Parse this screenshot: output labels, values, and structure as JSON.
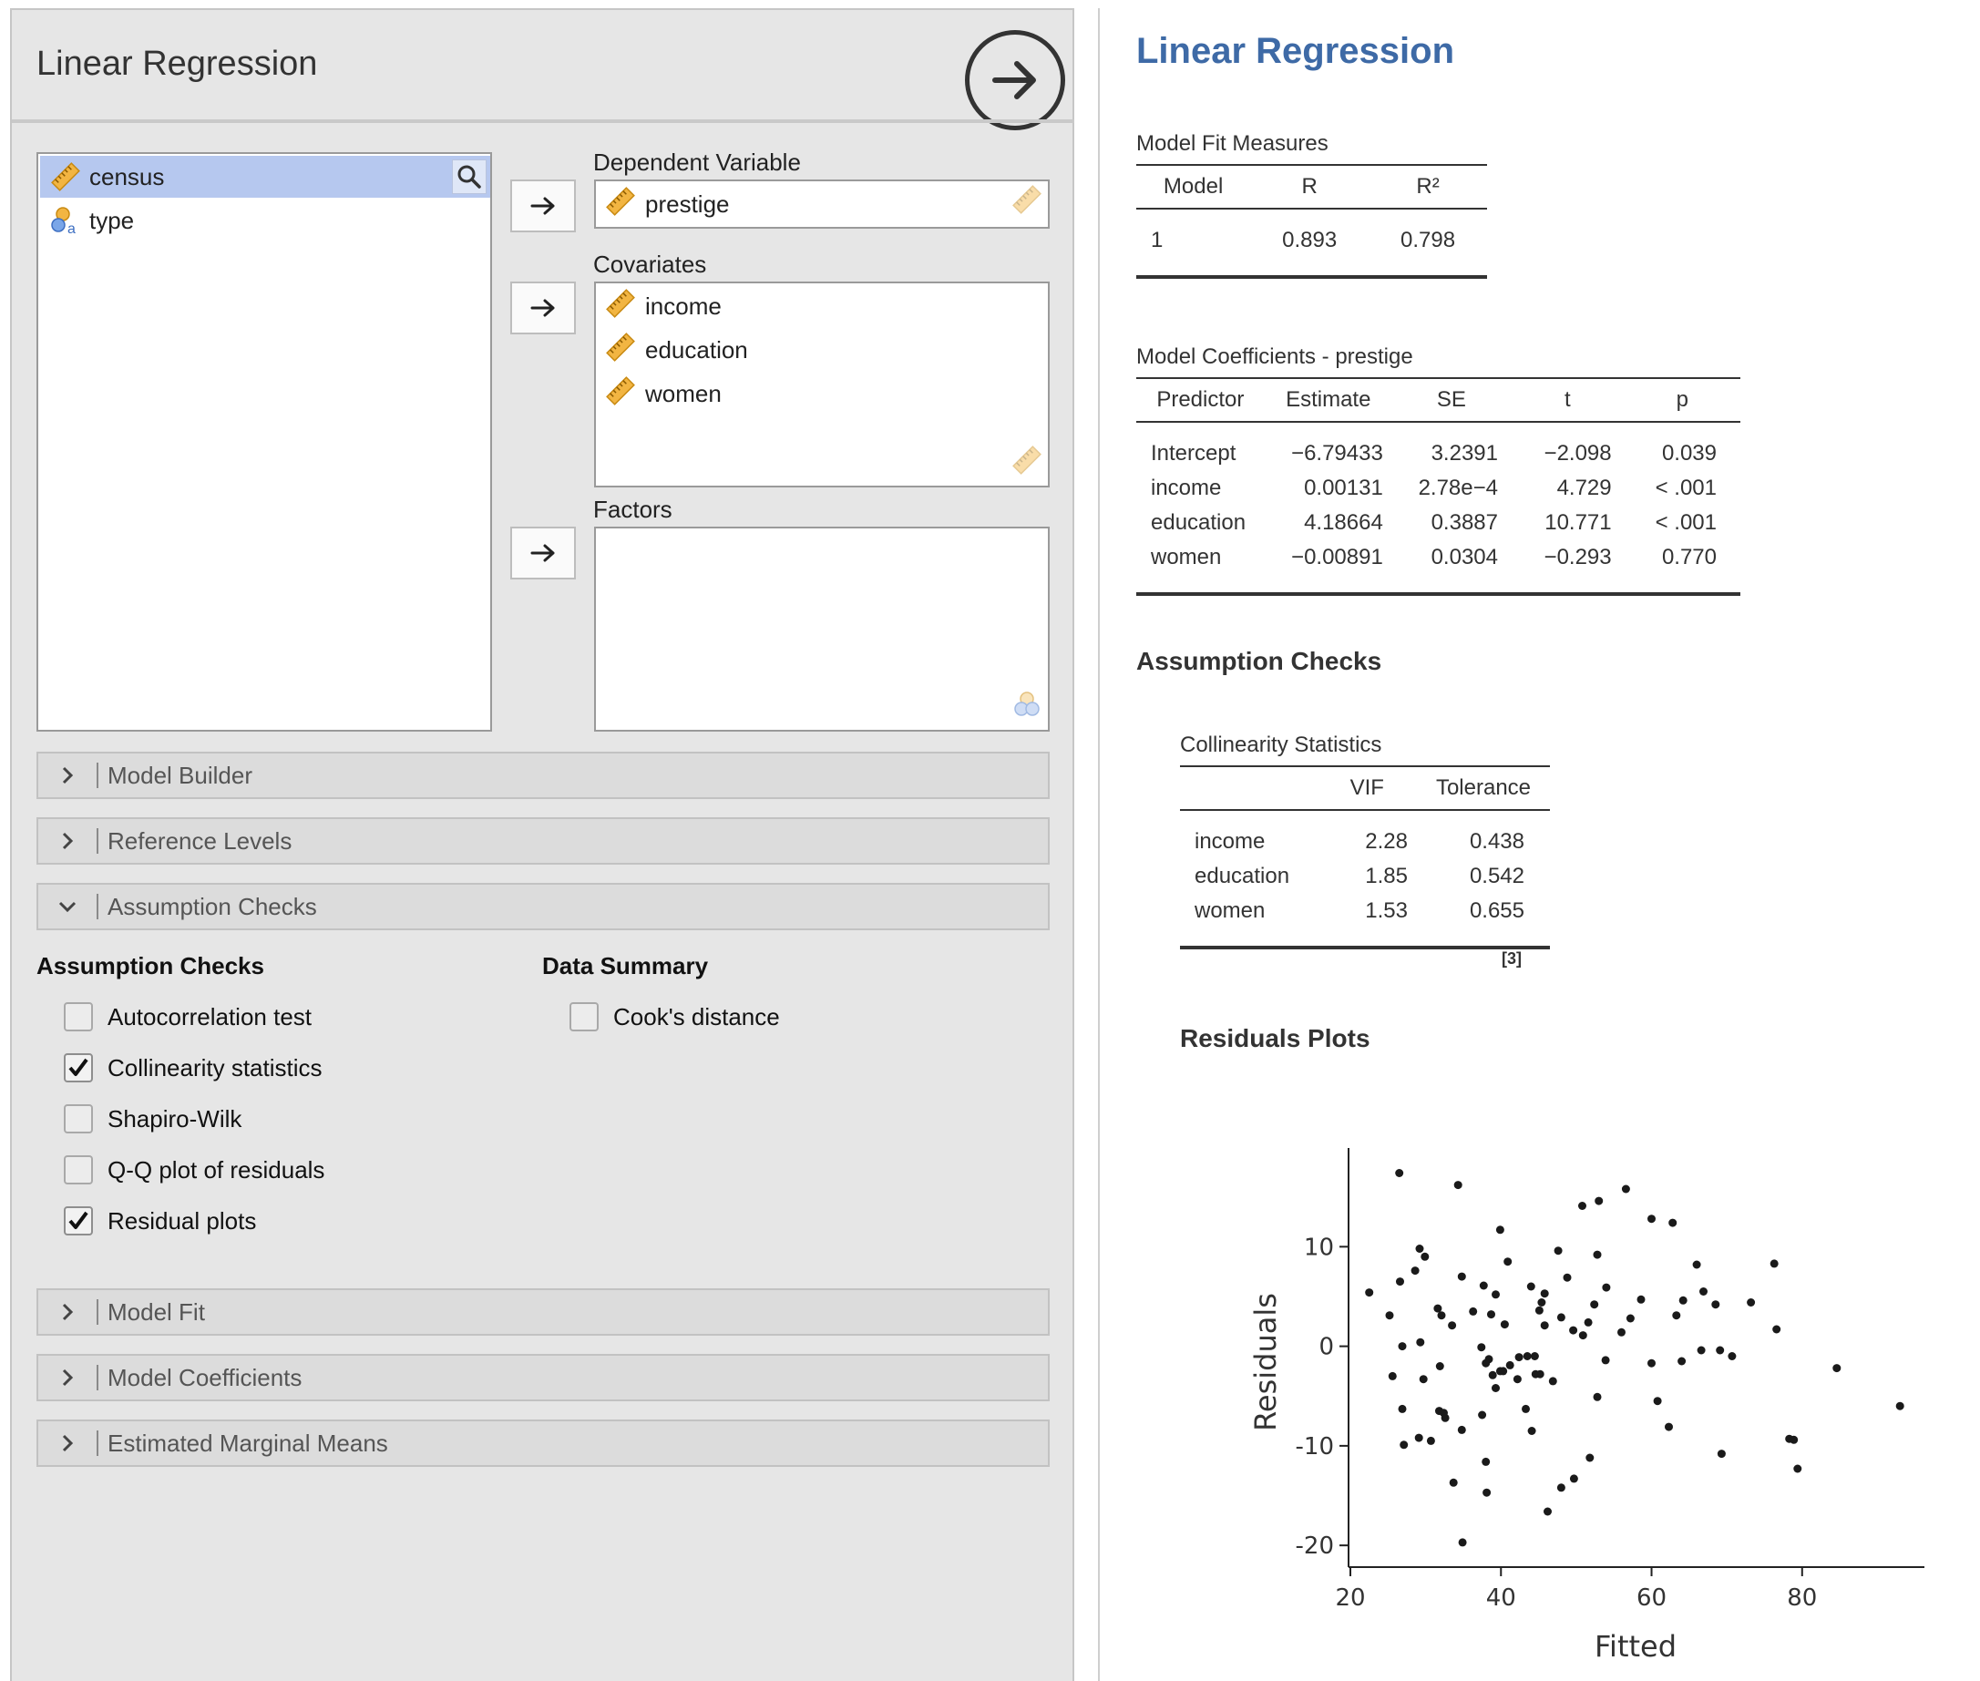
{
  "options": {
    "title": "Linear Regression",
    "variables": [
      {
        "name": "census",
        "icon": "scale-icon",
        "selected": true
      },
      {
        "name": "type",
        "icon": "nominal-icon",
        "selected": false
      }
    ],
    "dependent": {
      "label": "Dependent Variable",
      "items": [
        "prestige"
      ]
    },
    "covariates": {
      "label": "Covariates",
      "items": [
        "income",
        "education",
        "women"
      ]
    },
    "factors": {
      "label": "Factors",
      "items": []
    },
    "sections": {
      "model_builder": "Model Builder",
      "reference_levels": "Reference Levels",
      "assumption_checks": "Assumption Checks",
      "model_fit": "Model Fit",
      "model_coefficients": "Model Coefficients",
      "estimated_marginal_means": "Estimated Marginal Means"
    },
    "assumption_group": {
      "title": "Assumption Checks",
      "items": [
        {
          "label": "Autocorrelation test",
          "checked": false
        },
        {
          "label": "Collinearity statistics",
          "checked": true
        },
        {
          "label": "Shapiro-Wilk",
          "checked": false
        },
        {
          "label": "Q-Q plot of residuals",
          "checked": false
        },
        {
          "label": "Residual plots",
          "checked": true
        }
      ]
    },
    "data_summary_group": {
      "title": "Data Summary",
      "items": [
        {
          "label": "Cook's distance",
          "checked": false
        }
      ]
    }
  },
  "results": {
    "title": "Linear Regression",
    "model_fit": {
      "title": "Model Fit Measures",
      "headers": [
        "Model",
        "R",
        "R²"
      ],
      "rows": [
        [
          "1",
          "0.893",
          "0.798"
        ]
      ]
    },
    "coefficients": {
      "title": "Model Coefficients - prestige",
      "headers": [
        "Predictor",
        "Estimate",
        "SE",
        "t",
        "p"
      ],
      "rows": [
        [
          "Intercept",
          "−6.79433",
          "3.2391",
          "−2.098",
          "0.039"
        ],
        [
          "income",
          "0.00131",
          "2.78e−4",
          "4.729",
          "< .001"
        ],
        [
          "education",
          "4.18664",
          "0.3887",
          "10.771",
          "< .001"
        ],
        [
          "women",
          "−0.00891",
          "0.0304",
          "−0.293",
          "0.770"
        ]
      ]
    },
    "assumption_checks_title": "Assumption Checks",
    "collinearity": {
      "title": "Collinearity Statistics",
      "headers": [
        "",
        "VIF",
        "Tolerance"
      ],
      "rows": [
        [
          "income",
          "2.28",
          "0.438"
        ],
        [
          "education",
          "1.85",
          "0.542"
        ],
        [
          "women",
          "1.53",
          "0.655"
        ]
      ],
      "note": "[3]"
    },
    "residuals_title": "Residuals Plots"
  },
  "chart_data": {
    "type": "scatter",
    "xlabel": "Fitted",
    "ylabel": "Residuals",
    "xticks": [
      20,
      40,
      60,
      80
    ],
    "yticks": [
      -20,
      -10,
      0,
      10
    ],
    "xlim": [
      20,
      96
    ],
    "ylim": [
      -22,
      19
    ],
    "grid": false,
    "points": [
      [
        26.5,
        17.4
      ],
      [
        34.3,
        16.2
      ],
      [
        56.6,
        15.8
      ],
      [
        53.0,
        14.6
      ],
      [
        50.8,
        14.1
      ],
      [
        60.0,
        12.8
      ],
      [
        62.8,
        12.4
      ],
      [
        39.9,
        11.7
      ],
      [
        29.2,
        9.8
      ],
      [
        29.9,
        9.0
      ],
      [
        47.6,
        9.6
      ],
      [
        52.8,
        9.2
      ],
      [
        40.9,
        8.5
      ],
      [
        66.0,
        8.2
      ],
      [
        76.3,
        8.3
      ],
      [
        28.6,
        7.6
      ],
      [
        34.8,
        7.0
      ],
      [
        48.8,
        6.9
      ],
      [
        26.6,
        6.5
      ],
      [
        37.7,
        6.1
      ],
      [
        44.0,
        6.0
      ],
      [
        54.0,
        5.9
      ],
      [
        22.5,
        5.4
      ],
      [
        39.3,
        5.2
      ],
      [
        45.8,
        5.3
      ],
      [
        66.9,
        5.5
      ],
      [
        58.6,
        4.7
      ],
      [
        64.2,
        4.6
      ],
      [
        45.4,
        4.4
      ],
      [
        52.4,
        4.2
      ],
      [
        68.5,
        4.2
      ],
      [
        73.2,
        4.4
      ],
      [
        31.6,
        3.8
      ],
      [
        36.3,
        3.5
      ],
      [
        45.1,
        3.6
      ],
      [
        25.2,
        3.1
      ],
      [
        32.1,
        3.1
      ],
      [
        38.7,
        3.2
      ],
      [
        48.0,
        2.9
      ],
      [
        51.6,
        2.4
      ],
      [
        57.2,
        2.8
      ],
      [
        63.3,
        3.1
      ],
      [
        33.5,
        2.1
      ],
      [
        40.5,
        2.2
      ],
      [
        45.8,
        2.1
      ],
      [
        49.6,
        1.6
      ],
      [
        56.0,
        1.4
      ],
      [
        76.6,
        1.7
      ],
      [
        50.9,
        1.1
      ],
      [
        29.3,
        0.4
      ],
      [
        26.9,
        0.0
      ],
      [
        37.4,
        -0.1
      ],
      [
        66.6,
        -0.4
      ],
      [
        69.1,
        -0.4
      ],
      [
        70.7,
        -1.0
      ],
      [
        43.5,
        -1.0
      ],
      [
        44.5,
        -1.0
      ],
      [
        42.4,
        -1.1
      ],
      [
        38.4,
        -1.3
      ],
      [
        38.0,
        -1.7
      ],
      [
        53.9,
        -1.4
      ],
      [
        60.0,
        -1.7
      ],
      [
        64.0,
        -1.5
      ],
      [
        31.9,
        -2.0
      ],
      [
        41.2,
        -1.9
      ],
      [
        84.6,
        -2.2
      ],
      [
        39.9,
        -2.5
      ],
      [
        40.3,
        -2.5
      ],
      [
        38.9,
        -2.9
      ],
      [
        44.6,
        -2.8
      ],
      [
        25.6,
        -3.0
      ],
      [
        45.2,
        -2.8
      ],
      [
        42.2,
        -3.3
      ],
      [
        29.7,
        -3.3
      ],
      [
        46.9,
        -3.5
      ],
      [
        39.3,
        -4.2
      ],
      [
        52.8,
        -5.1
      ],
      [
        60.8,
        -5.5
      ],
      [
        43.3,
        -6.3
      ],
      [
        93.0,
        -6.0
      ],
      [
        26.9,
        -6.3
      ],
      [
        31.8,
        -6.5
      ],
      [
        32.4,
        -6.7
      ],
      [
        32.6,
        -7.2
      ],
      [
        37.5,
        -6.9
      ],
      [
        62.3,
        -8.1
      ],
      [
        34.8,
        -8.4
      ],
      [
        44.1,
        -8.5
      ],
      [
        29.1,
        -9.2
      ],
      [
        30.7,
        -9.5
      ],
      [
        78.3,
        -9.3
      ],
      [
        78.9,
        -9.4
      ],
      [
        27.1,
        -9.9
      ],
      [
        69.3,
        -10.8
      ],
      [
        51.8,
        -11.2
      ],
      [
        38.0,
        -11.6
      ],
      [
        79.4,
        -12.3
      ],
      [
        49.7,
        -13.3
      ],
      [
        33.7,
        -13.7
      ],
      [
        48.0,
        -14.2
      ],
      [
        38.1,
        -14.7
      ],
      [
        46.2,
        -16.6
      ],
      [
        34.9,
        -19.7
      ]
    ]
  }
}
